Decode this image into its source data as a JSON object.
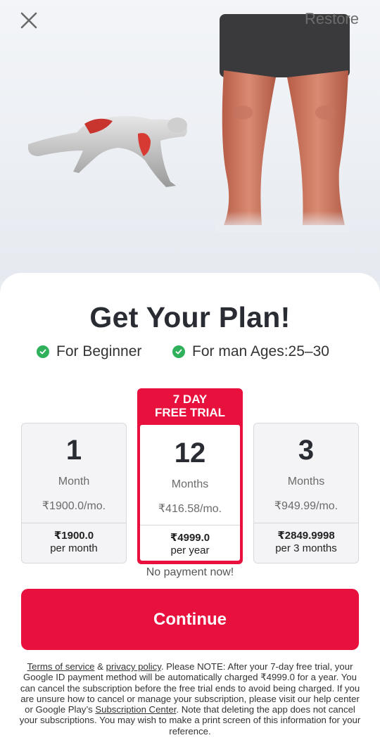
{
  "header": {
    "close_icon": "close-icon",
    "restore_label": "Restore"
  },
  "sheet": {
    "title": "Get Your Plan!",
    "features": [
      {
        "icon": "check-circle-icon",
        "label": "For Beginner"
      },
      {
        "icon": "check-circle-icon",
        "label": "For man Ages:25–30"
      }
    ],
    "plans": [
      {
        "number": "1",
        "unit": "Month",
        "per_month": "₹1900.0/mo.",
        "total": "₹1900.0",
        "period": "per month",
        "selected": false
      },
      {
        "badge_line1": "7 DAY",
        "badge_line2": "FREE TRIAL",
        "number": "12",
        "unit": "Months",
        "per_month": "₹416.58/mo.",
        "total": "₹4999.0",
        "period": "per year",
        "selected": true
      },
      {
        "number": "3",
        "unit": "Months",
        "per_month": "₹949.99/mo.",
        "total": "₹2849.9998",
        "period": "per 3 months",
        "selected": false
      }
    ],
    "no_payment": "No payment now!",
    "continue_label": "Continue",
    "legal": {
      "terms_link": "Terms of service",
      "and": " & ",
      "privacy_link": "privacy policy",
      "text1": ". Please NOTE: After your 7-day free trial, your Google ID payment method will be automatically charged ₹4999.0 for a year. You can cancel the subscription before the free trial ends to avoid being charged. If you are unsure how to cancel or manage your subscription, please visit our help center or Google Play’s ",
      "subscription_link": "Subscription Center",
      "text2": ". Note that deleting the app does not cancel your subscriptions. You may wish to make a print screen of this information for your reference."
    }
  },
  "colors": {
    "accent": "#e8103c",
    "check": "#2fb05b",
    "title": "#2a2c33"
  }
}
